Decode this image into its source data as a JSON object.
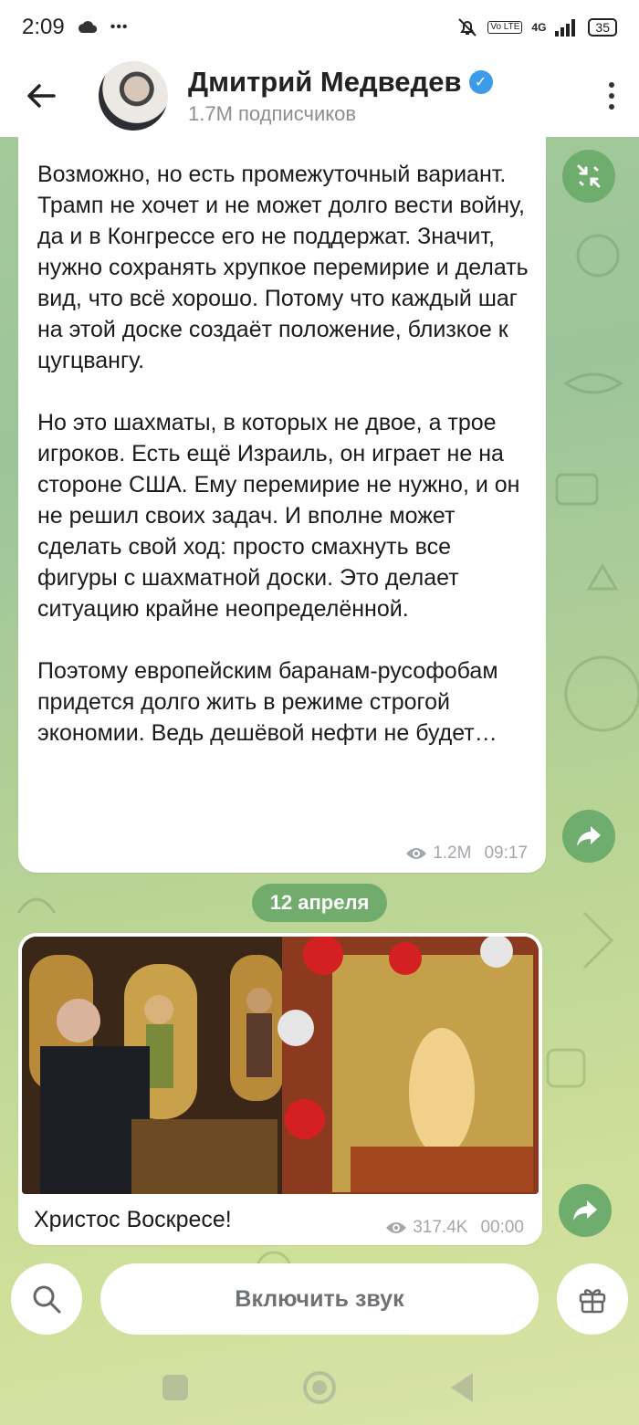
{
  "status_bar": {
    "time": "2:09",
    "dots": "•••",
    "volte": "Vo LTE",
    "network": "4G",
    "battery": "35",
    "icons": [
      "cloud-icon",
      "mute-bell-icon",
      "signal-icon",
      "battery-icon"
    ]
  },
  "header": {
    "channel_name": "Дмитрий Медведев",
    "subscribers": "1.7M подписчиков",
    "icons": [
      "back-arrow-icon",
      "verified-icon",
      "more-vert-icon"
    ]
  },
  "messages": [
    {
      "text": "Возможно, но есть промежуточный вариант. Трамп не хочет и не может долго вести войну, да и в Конгрессе его не поддержат. Значит, нужно сохранять хрупкое перемирие и делать вид, что всё хорошо. Потому что каждый шаг на этой доске создаёт положение, близкое к цугцвангу.\n\nНо это шахматы, в которых не двое, а трое игроков. Есть ещё Израиль, он играет не на стороне США. Ему перемирие не нужно, и он не решил своих задач. И вполне может сделать свой ход: просто смахнуть все фигуры с шахматной доски. Это делает ситуацию крайне неопределённой.\n\nПоэтому европейским баранам-русофобам придется долго жить в режиме строгой экономии. Ведь дешёвой нефти не будет…",
      "views": "1.2M",
      "time": "09:17"
    },
    {
      "caption": "Христос Воскресе!",
      "views": "317.4K",
      "time": "00:00"
    }
  ],
  "date_separator": "12 апреля",
  "bottom_bar": {
    "unmute_label": "Включить звук",
    "icons": [
      "search-icon",
      "gift-icon"
    ]
  },
  "colors": {
    "accent_green": "#71ac6d",
    "verified_blue": "#3d9be9"
  }
}
